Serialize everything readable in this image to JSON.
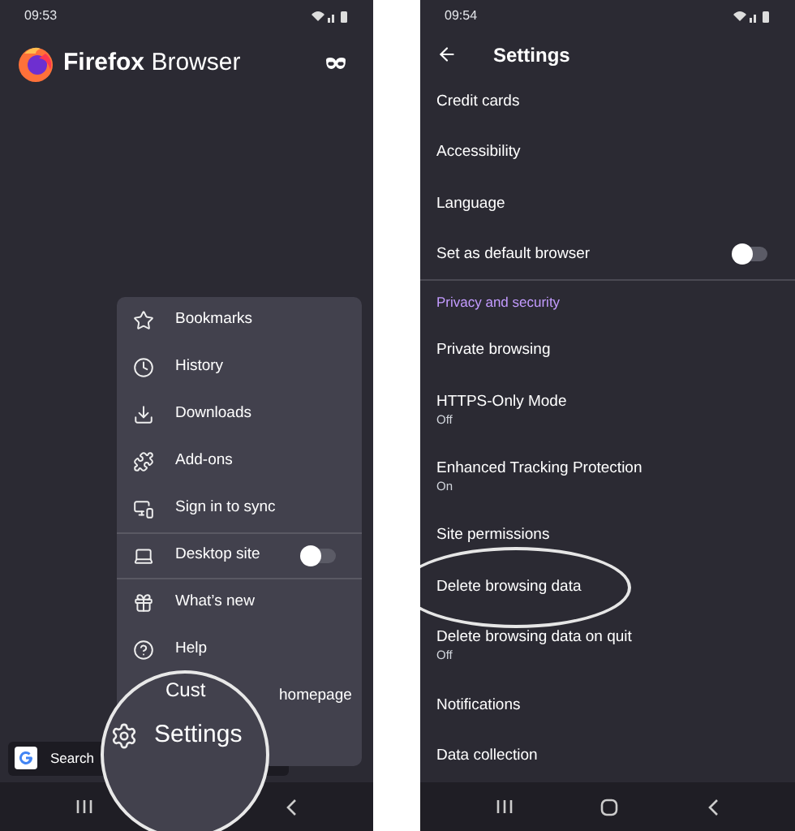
{
  "left_screen": {
    "status_bar": {
      "time": "09:53"
    },
    "app_title": {
      "brand": "Firefox",
      "product": "Browser"
    },
    "menu": {
      "items": [
        {
          "kind": "item",
          "label": "Bookmarks"
        },
        {
          "kind": "item",
          "label": "History"
        },
        {
          "kind": "item",
          "label": "Downloads"
        },
        {
          "kind": "item",
          "label": "Add-ons"
        },
        {
          "kind": "item",
          "label": "Sign in to sync"
        },
        {
          "kind": "toggle",
          "label": "Desktop site",
          "on": false
        },
        {
          "kind": "item",
          "label": "What’s new"
        },
        {
          "kind": "item",
          "label": "Help"
        },
        {
          "kind": "partial",
          "label": "homepage"
        }
      ]
    },
    "search_bar": {
      "placeholder": "Search"
    },
    "magnifier": {
      "fragment": "Cust",
      "label": "Settings"
    }
  },
  "right_screen": {
    "status_bar": {
      "time": "09:54"
    },
    "header": {
      "title": "Settings"
    },
    "rows": [
      {
        "kind": "row",
        "label": "Credit cards",
        "circled": false
      },
      {
        "kind": "row",
        "label": "Accessibility",
        "circled": false
      },
      {
        "kind": "row",
        "label": "Language",
        "circled": false
      },
      {
        "kind": "toggle",
        "label": "Set as default browser",
        "on": false,
        "circled": false
      },
      {
        "kind": "section",
        "label": "Privacy and security",
        "circled": false
      },
      {
        "kind": "row",
        "label": "Private browsing",
        "circled": false
      },
      {
        "kind": "row",
        "label": "HTTPS-Only Mode",
        "summary": "Off",
        "circled": false
      },
      {
        "kind": "row",
        "label": "Enhanced Tracking Protection",
        "summary": "On",
        "circled": false
      },
      {
        "kind": "row",
        "label": "Site permissions",
        "circled": false
      },
      {
        "kind": "row",
        "label": "Delete browsing data",
        "circled": true
      },
      {
        "kind": "row",
        "label": "Delete browsing data on quit",
        "summary": "Off",
        "circled": false
      },
      {
        "kind": "row",
        "label": "Notifications",
        "circled": false
      },
      {
        "kind": "row",
        "label": "Data collection",
        "circled": false
      }
    ]
  }
}
